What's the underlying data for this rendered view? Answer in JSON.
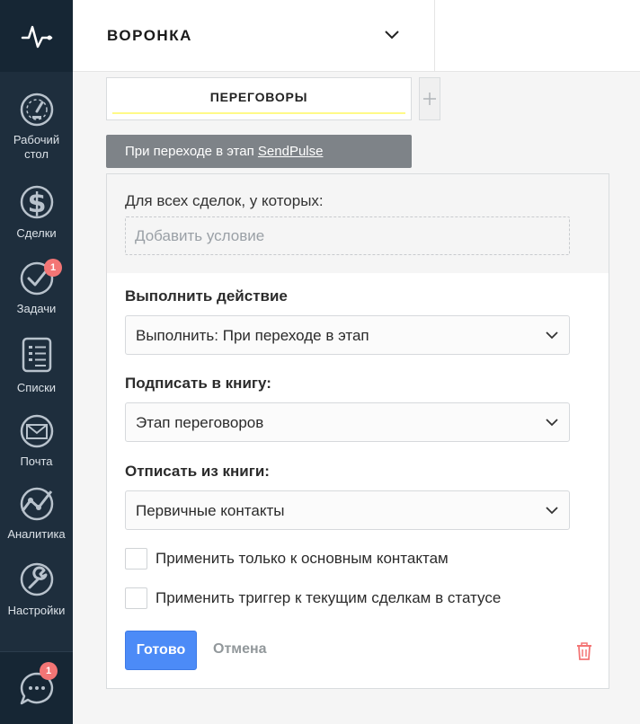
{
  "colors": {
    "sidebar_bg": "#1e2e3d",
    "accent_blue": "#4c8bf7",
    "badge_red": "#f37575",
    "trigger_bar": "#7e8388",
    "trash_red": "#f37575",
    "stage_underline": "#fffa88"
  },
  "sidebar": {
    "logo_icon": "pulse-icon",
    "items": [
      {
        "icon": "dashboard-icon",
        "label_line1": "Рабочий",
        "label_line2": "стол"
      },
      {
        "icon": "dollar-icon",
        "label": "Сделки"
      },
      {
        "icon": "tasks-icon",
        "label": "Задачи",
        "badge": "1"
      },
      {
        "icon": "lists-icon",
        "label": "Списки"
      },
      {
        "icon": "mail-icon",
        "label": "Почта"
      },
      {
        "icon": "analytics-icon",
        "label": "Аналитика"
      },
      {
        "icon": "settings-icon",
        "label": "Настройки"
      }
    ],
    "chat": {
      "icon": "chat-icon",
      "badge": "1"
    }
  },
  "header": {
    "title": "ВОРОНКА"
  },
  "stage": {
    "name": "ПЕРЕГОВОРЫ",
    "add_label": "+"
  },
  "trigger": {
    "prefix": "При переходе в этап",
    "link": "SendPulse"
  },
  "panel": {
    "condition_label": "Для всех сделок, у которых:",
    "condition_placeholder": "Добавить условие",
    "action_label": "Выполнить действие",
    "action_value": "Выполнить: При переходе в этап",
    "subscribe_label": "Подписать в книгу:",
    "subscribe_value": "Этап переговоров",
    "unsubscribe_label": "Отписать из книги:",
    "unsubscribe_value": "Первичные контакты",
    "check1_label": "Применить только к основным контактам",
    "check1_checked": false,
    "check2_label": "Применить триггер к текущим сделкам в статусе",
    "check2_checked": false,
    "done_label": "Готово",
    "cancel_label": "Отмена"
  }
}
